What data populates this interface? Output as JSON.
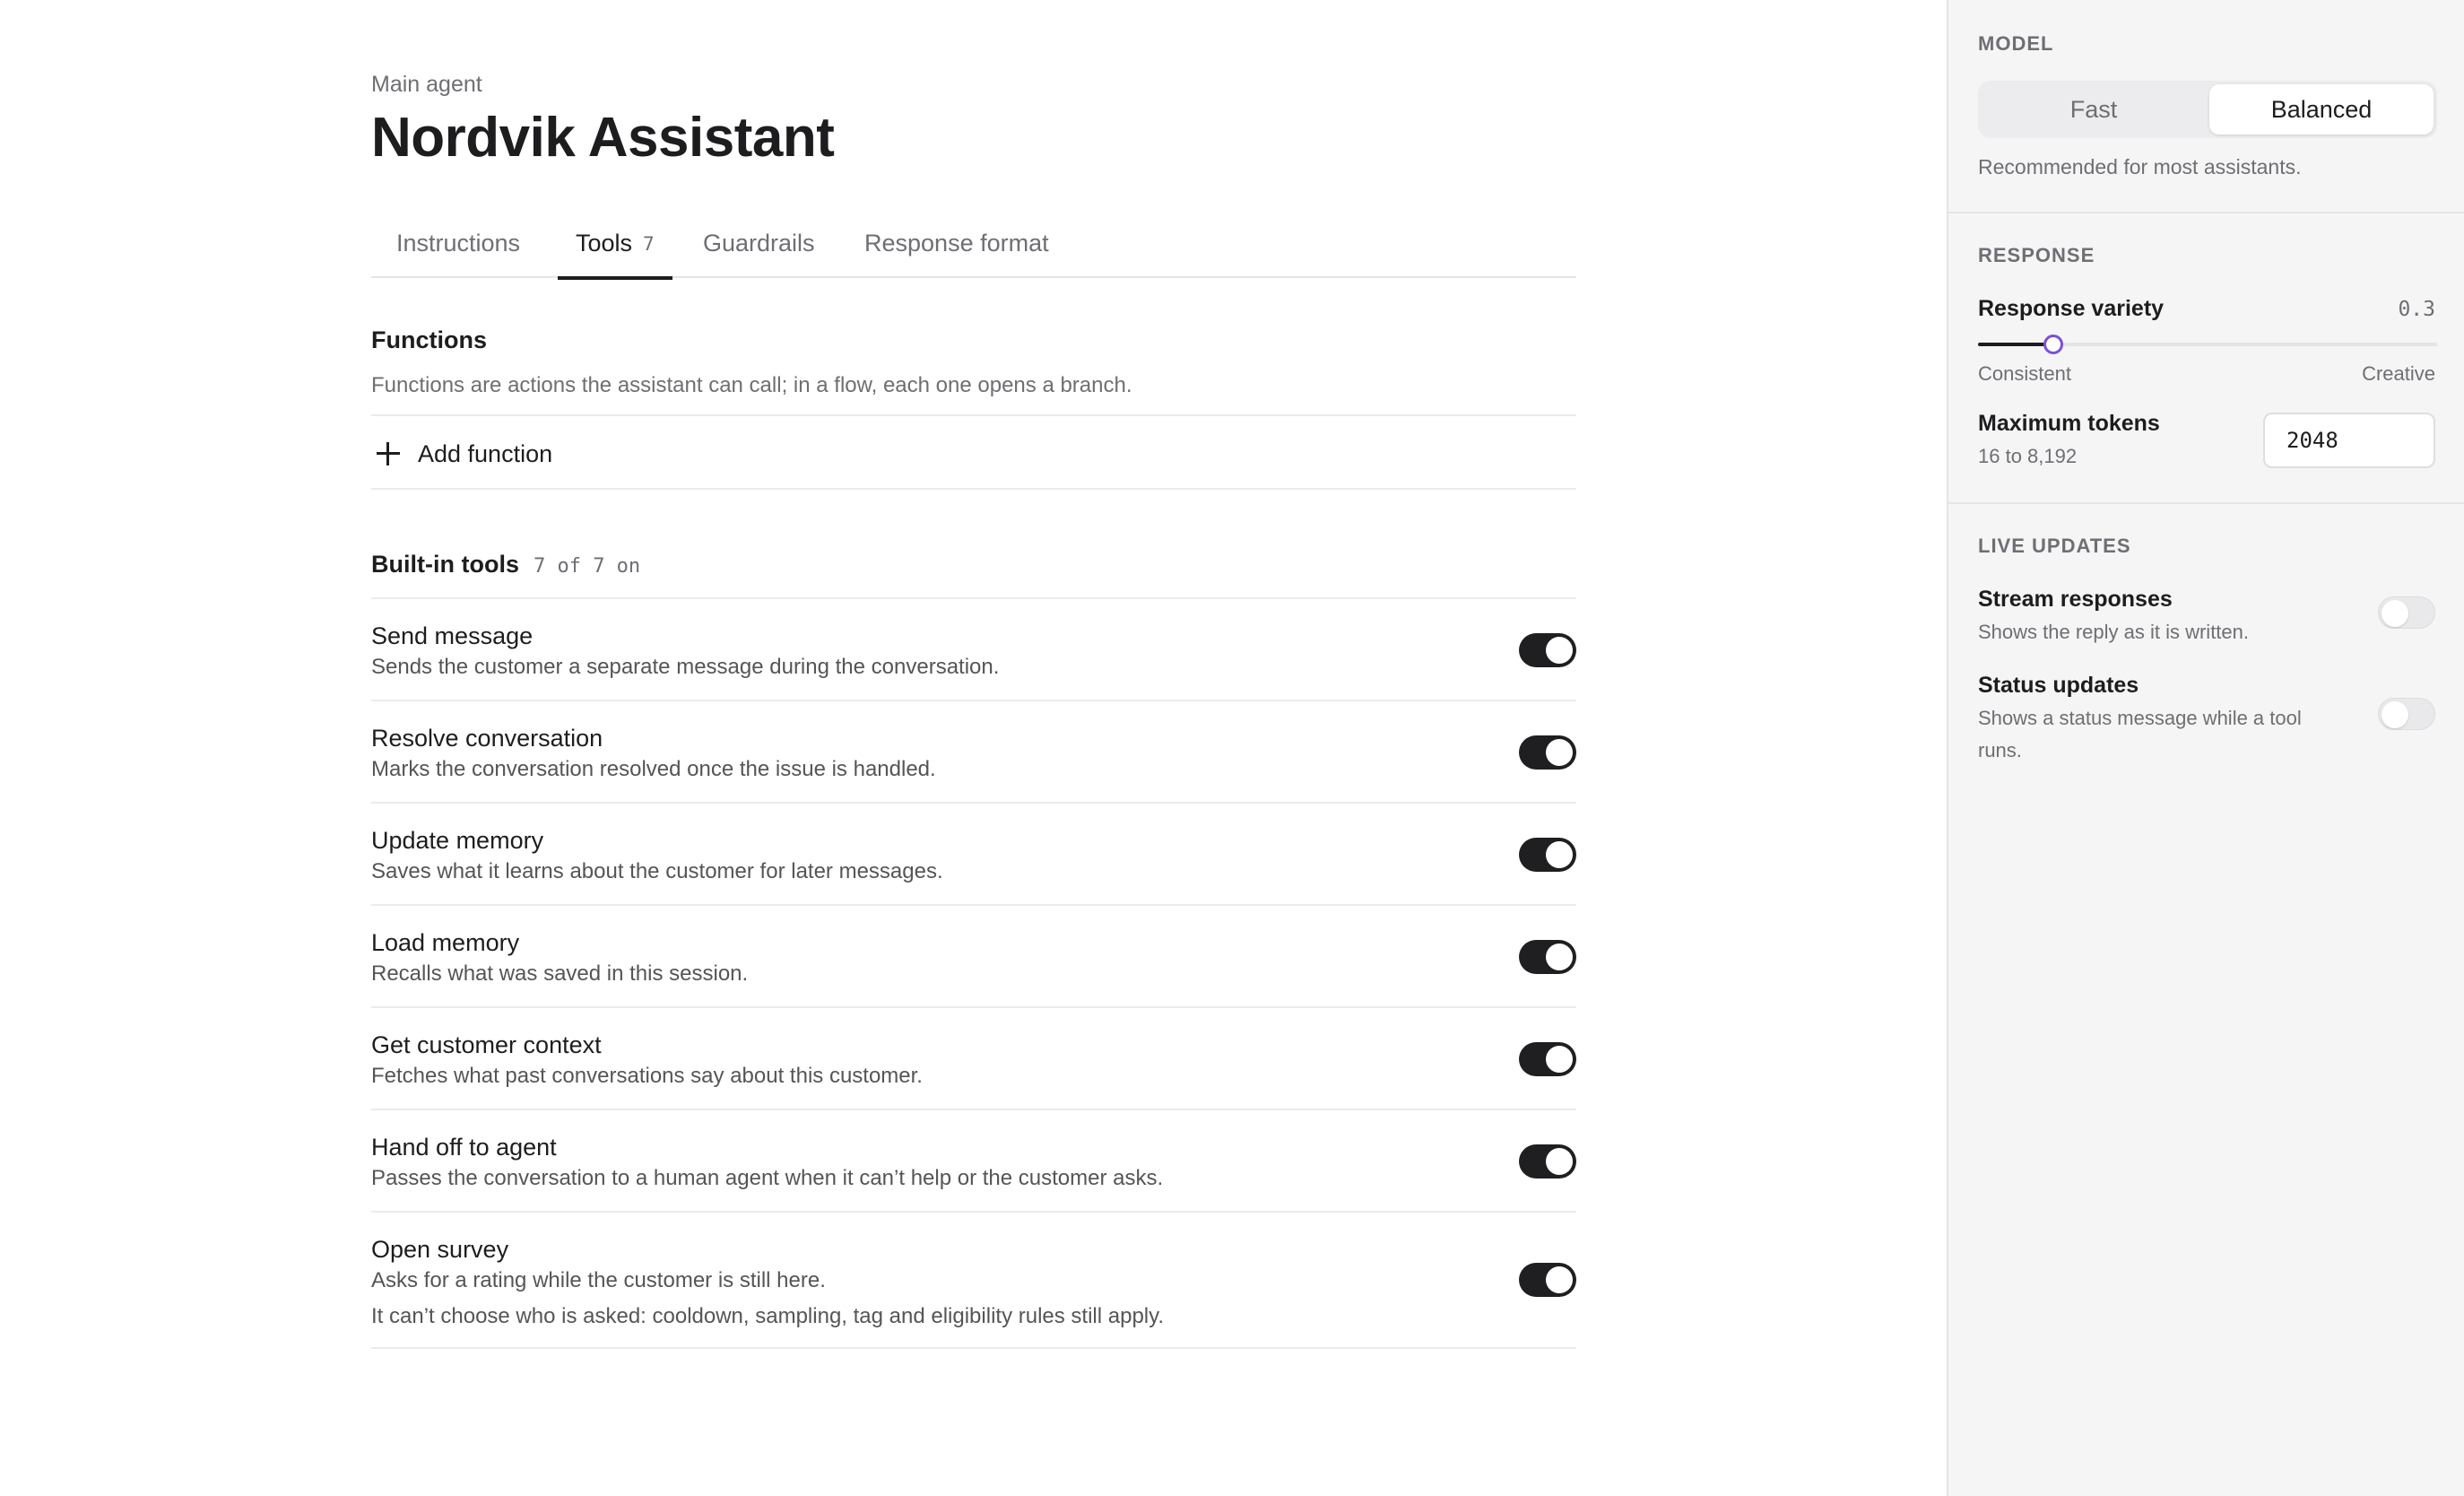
{
  "header": {
    "subtitle": "Main agent",
    "title": "Nordvik Assistant"
  },
  "tabs": [
    {
      "label": "Instructions",
      "active": false
    },
    {
      "label": "Tools",
      "count": "7",
      "active": true
    },
    {
      "label": "Guardrails",
      "active": false
    },
    {
      "label": "Response format",
      "active": false
    }
  ],
  "functions": {
    "title": "Functions",
    "description": "Functions are actions the assistant can call; in a flow, each one opens a branch.",
    "add_label": "Add function"
  },
  "builtin": {
    "title": "Built-in tools",
    "count": "7 of 7 on",
    "tools": [
      {
        "name": "Send message",
        "description": "Sends the customer a separate message during the conversation.",
        "enabled": true
      },
      {
        "name": "Resolve conversation",
        "description": "Marks the conversation resolved once the issue is handled.",
        "enabled": true
      },
      {
        "name": "Update memory",
        "description": "Saves what it learns about the customer for later messages.",
        "enabled": true
      },
      {
        "name": "Load memory",
        "description": "Recalls what was saved in this session.",
        "enabled": true
      },
      {
        "name": "Get customer context",
        "description": "Fetches what past conversations say about this customer.",
        "enabled": true
      },
      {
        "name": "Hand off to agent",
        "description": "Passes the conversation to a human agent when it can’t help or the customer asks.",
        "enabled": true
      },
      {
        "name": "Open survey",
        "description": "Asks for a rating while the customer is still here.",
        "description2": "It can’t choose who is asked: cooldown, sampling, tag and eligibility rules still apply.",
        "enabled": true
      }
    ]
  },
  "panel": {
    "model": {
      "caption": "MODEL",
      "options": [
        "Fast",
        "Balanced"
      ],
      "selected": "Balanced",
      "note": "Recommended for most assistants."
    },
    "response": {
      "caption": "RESPONSE",
      "variety_label": "Response variety",
      "variety_value": "0.3",
      "variety_fraction": 0.165,
      "min_label": "Consistent",
      "max_label": "Creative",
      "tokens_label": "Maximum tokens",
      "tokens_range": "16 to 8,192",
      "tokens_value": "2048"
    },
    "live": {
      "caption": "LIVE UPDATES",
      "stream_label": "Stream responses",
      "stream_desc": "Shows the reply as it is written.",
      "stream_enabled": false,
      "status_label": "Status updates",
      "status_desc_line1": "Shows a status message while a tool",
      "status_desc_line2": "runs.",
      "status_enabled": false
    }
  }
}
